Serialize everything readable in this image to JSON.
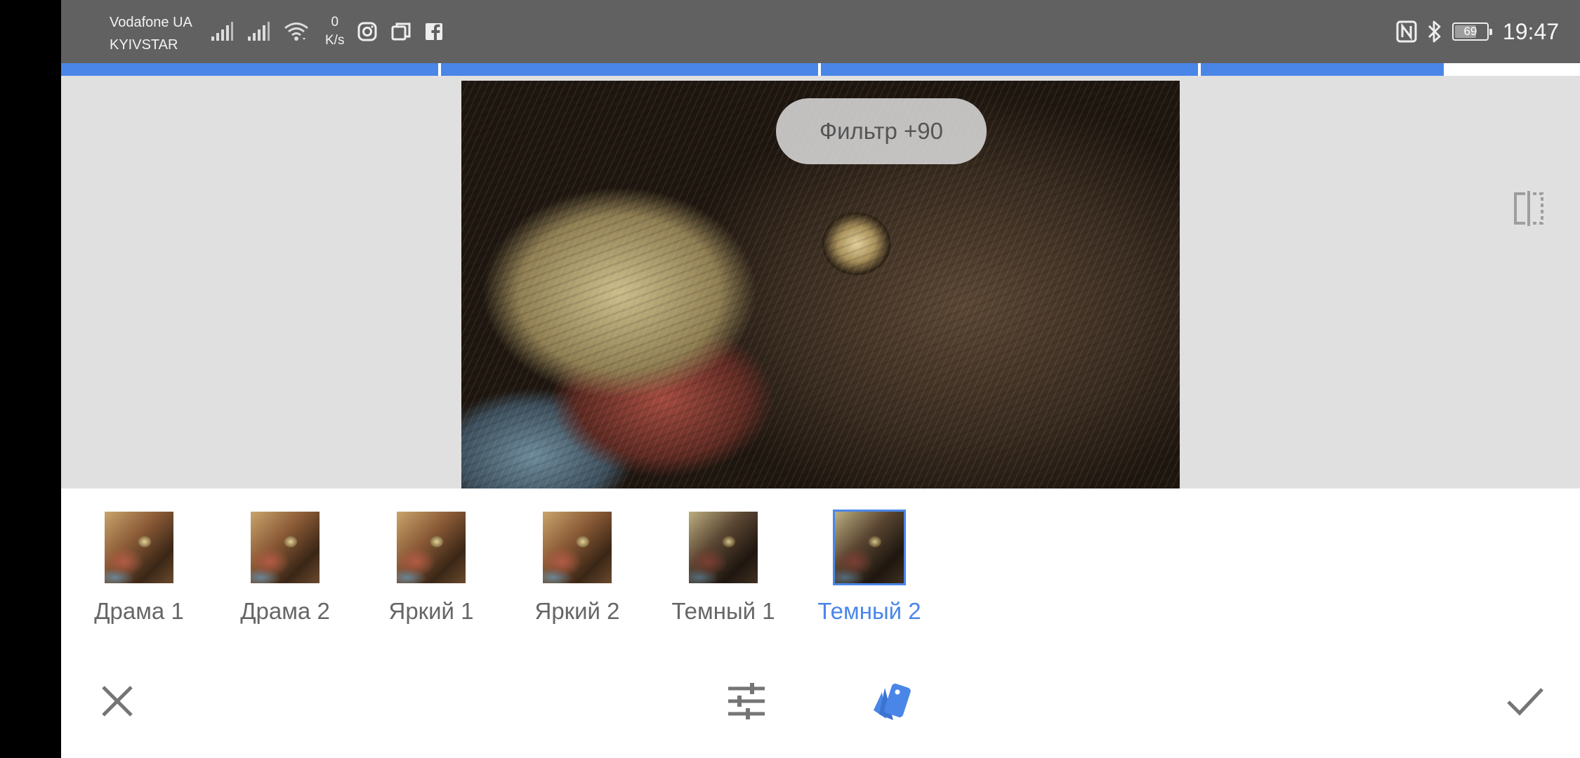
{
  "status_bar": {
    "carrier_1": "Vodafone UA",
    "carrier_2": "KYIVSTAR",
    "net_speed_value": "0",
    "net_speed_unit": "K/s",
    "battery_percent": "69",
    "battery_level": 0.69,
    "time": "19:47",
    "icons_left": [
      "signal-icon",
      "signal-icon",
      "wifi-icon",
      "instagram-icon",
      "recent-apps-icon",
      "facebook-icon"
    ],
    "icons_right": [
      "nfc-icon",
      "bluetooth-icon",
      "battery-icon"
    ]
  },
  "progress": {
    "segments": 4,
    "color": "#4a86e8"
  },
  "preview": {
    "filter_strength_label": "Фильтр +90",
    "compare_icon": "compare-icon"
  },
  "filters": {
    "items": [
      {
        "label": "Драма 1",
        "selected": false
      },
      {
        "label": "Драма 2",
        "selected": false
      },
      {
        "label": "Яркий 1",
        "selected": false
      },
      {
        "label": "Яркий 2",
        "selected": false
      },
      {
        "label": "Темный 1",
        "selected": false
      },
      {
        "label": "Темный 2",
        "selected": true
      }
    ],
    "accent_color": "#4a86e8"
  },
  "toolbar": {
    "cancel_icon": "close-icon",
    "tune_icon": "sliders-icon",
    "styles_icon": "style-cards-icon",
    "apply_icon": "check-icon"
  }
}
